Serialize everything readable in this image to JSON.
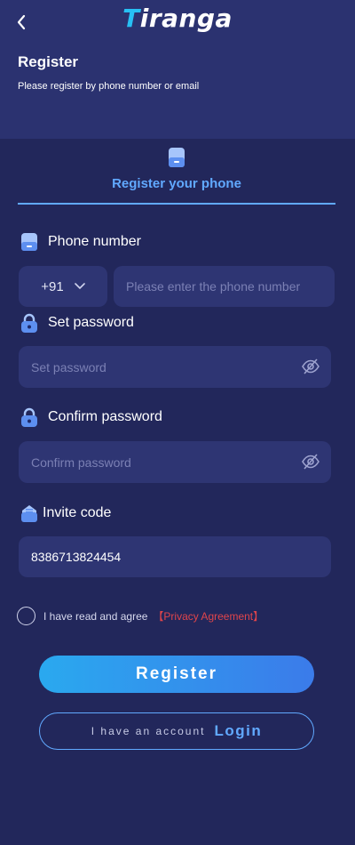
{
  "header": {
    "logo_text": "iranga",
    "logo_mark": "T",
    "title": "Register",
    "subtitle": "Please register by phone number or email"
  },
  "tab": {
    "label": "Register your phone"
  },
  "phone": {
    "label": "Phone number",
    "country_code": "+91",
    "placeholder": "Please enter the phone number",
    "value": ""
  },
  "password": {
    "label": "Set password",
    "placeholder": "Set password",
    "value": ""
  },
  "confirm": {
    "label": "Confirm password",
    "placeholder": "Confirm password",
    "value": ""
  },
  "invite": {
    "label": "Invite code",
    "value": "8386713824454"
  },
  "agreement": {
    "text": "I have read and agree",
    "link": "【Privacy Agreement】"
  },
  "buttons": {
    "register": "Register",
    "have_account": "I have an account",
    "login": "Login"
  },
  "colors": {
    "background": "#22275b",
    "header": "#2b3270",
    "input": "#2e3573",
    "accent": "#61a9ff",
    "link_red": "#e0454b"
  },
  "icons": [
    "back-arrow-icon",
    "phone-icon",
    "lock-icon",
    "eye-off-icon",
    "invite-icon",
    "chevron-down-icon"
  ]
}
